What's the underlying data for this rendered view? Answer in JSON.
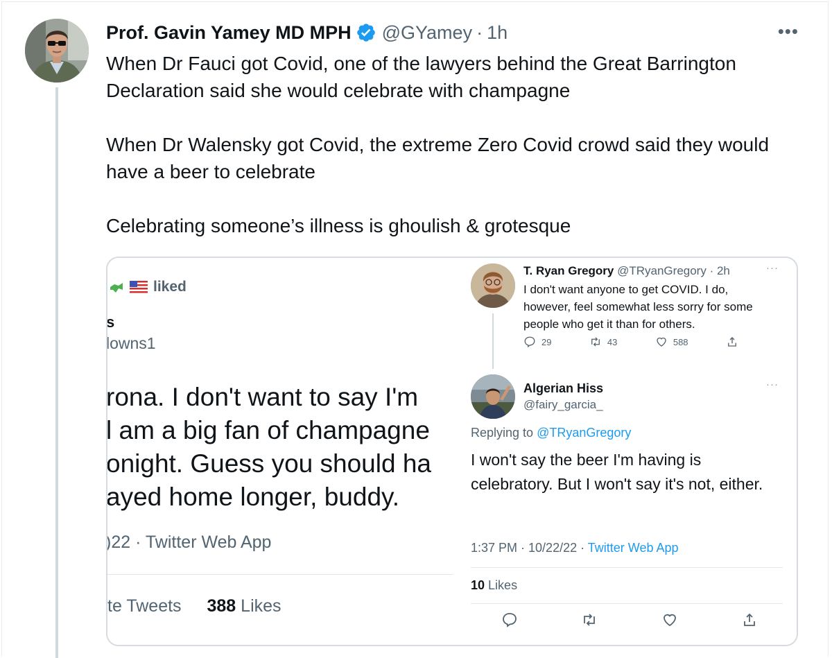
{
  "tweet": {
    "author_name": "Prof. Gavin Yamey MD MPH",
    "handle": "@GYamey",
    "separator": "·",
    "time": "1h",
    "more_label": "•••",
    "paragraphs": [
      "When Dr Fauci got Covid, one of the lawyers behind the Great Barrington Declaration said she would celebrate with champagne",
      "When Dr Walensky got Covid, the extreme Zero Covid crowd said they would have a beer to celebrate",
      "Celebrating someone’s illness is ghoulish & grotesque"
    ]
  },
  "left_screenshot": {
    "liked_label": "liked",
    "name_fragment": "s",
    "handle_fragment": "lowns1",
    "body_lines": [
      "rona.  I don't want to say I'm",
      "l am a big fan of champagne",
      "onight.  Guess you should ha",
      "ayed home longer, buddy."
    ],
    "meta": ")22 · Twitter Web App",
    "retweets_fragment": "te Tweets",
    "likes_count": "388",
    "likes_label": "Likes"
  },
  "right_screenshot": {
    "tweet1": {
      "name": "T. Ryan Gregory",
      "handle_time": "@TRyanGregory · 2h",
      "more_label": "···",
      "text": "I don't want anyone to get COVID. I do, however, feel somewhat less sorry for some people who get it than for others.",
      "replies": "29",
      "retweets": "43",
      "likes": "588"
    },
    "tweet2": {
      "name": "Algerian Hiss",
      "handle": "@fairy_garcia_",
      "more_label": "···",
      "replying_prefix": "Replying to",
      "replying_to": "@TRyanGregory",
      "text": "I won't say the beer I'm having is celebratory.  But I won't say it's not, either.",
      "timestamp": "1:37 PM · 10/22/22 · ",
      "app": "Twitter Web App",
      "likes_count": "10",
      "likes_label": "Likes"
    }
  },
  "colors": {
    "text": "#0f1419",
    "secondary": "#536471",
    "accent": "#1d9bf0",
    "border": "#cfd9de"
  },
  "icons": [
    "verified-badge-icon",
    "more-icon",
    "reply-icon",
    "retweet-icon",
    "like-icon",
    "share-icon",
    "crocodile-emoji-icon",
    "us-flag-emoji-icon"
  ]
}
